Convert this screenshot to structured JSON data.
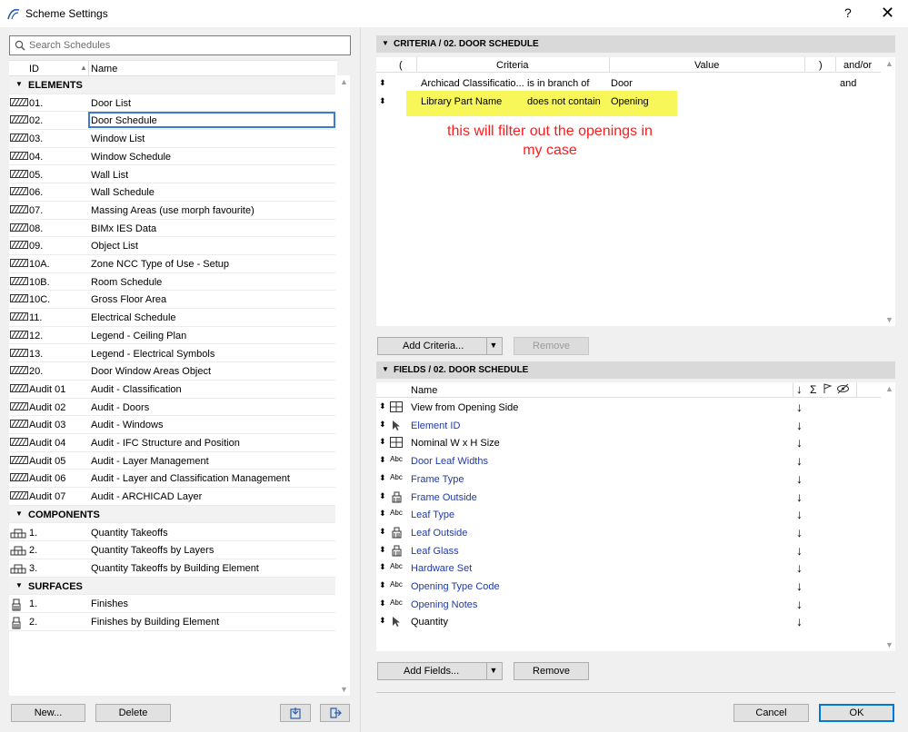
{
  "window": {
    "title": "Scheme Settings",
    "help": "?",
    "close": "✕"
  },
  "search": {
    "placeholder": "Search Schedules"
  },
  "list": {
    "col_id": "ID",
    "col_name": "Name",
    "groups": {
      "elements": "ELEMENTS",
      "components": "COMPONENTS",
      "surfaces": "SURFACES"
    },
    "elements": [
      {
        "id": "01.",
        "name": "Door List"
      },
      {
        "id": "02.",
        "name": "Door Schedule"
      },
      {
        "id": "03.",
        "name": "Window List"
      },
      {
        "id": "04.",
        "name": "Window Schedule"
      },
      {
        "id": "05.",
        "name": "Wall List"
      },
      {
        "id": "06.",
        "name": "Wall Schedule"
      },
      {
        "id": "07.",
        "name": "Massing Areas (use morph favourite)"
      },
      {
        "id": "08.",
        "name": "BIMx IES Data"
      },
      {
        "id": "09.",
        "name": "Object List"
      },
      {
        "id": "10A.",
        "name": "Zone NCC Type of Use - Setup"
      },
      {
        "id": "10B.",
        "name": "Room Schedule"
      },
      {
        "id": "10C.",
        "name": "Gross Floor Area"
      },
      {
        "id": "11.",
        "name": "Electrical Schedule"
      },
      {
        "id": "12.",
        "name": "Legend - Ceiling Plan"
      },
      {
        "id": "13.",
        "name": "Legend - Electrical Symbols"
      },
      {
        "id": "20.",
        "name": "Door Window Areas Object"
      },
      {
        "id": "Audit 01",
        "name": "Audit - Classification"
      },
      {
        "id": "Audit 02",
        "name": "Audit - Doors"
      },
      {
        "id": "Audit 03",
        "name": "Audit - Windows"
      },
      {
        "id": "Audit 04",
        "name": "Audit - IFC Structure and Position"
      },
      {
        "id": "Audit 05",
        "name": "Audit - Layer Management"
      },
      {
        "id": "Audit 06",
        "name": "Audit - Layer and Classification Management"
      },
      {
        "id": "Audit 07",
        "name": "Audit - ARCHICAD Layer"
      }
    ],
    "components": [
      {
        "id": "1.",
        "name": "Quantity Takeoffs"
      },
      {
        "id": "2.",
        "name": "Quantity Takeoffs by Layers"
      },
      {
        "id": "3.",
        "name": "Quantity Takeoffs by Building Element"
      }
    ],
    "surfaces": [
      {
        "id": "1.",
        "name": "Finishes"
      },
      {
        "id": "2.",
        "name": "Finishes by Building Element"
      }
    ]
  },
  "left_buttons": {
    "new": "New...",
    "delete": "Delete"
  },
  "criteria": {
    "title": "CRITERIA / 02. DOOR SCHEDULE",
    "headers": {
      "open": "(",
      "criteria": "Criteria",
      "value": "Value",
      "close": ")",
      "andor": "and/or"
    },
    "rows": [
      {
        "field": "Archicad Classificatio...",
        "op": "is in branch of",
        "value": "Door",
        "andor": "and"
      },
      {
        "field": "Library Part Name",
        "op": "does not contain",
        "value": "Opening",
        "andor": ""
      }
    ],
    "annotation_line1": "this will filter out the openings in",
    "annotation_line2": "my case",
    "add_button": "Add Criteria...",
    "remove_button": "Remove"
  },
  "fields": {
    "title": "FIELDS / 02. DOOR SCHEDULE",
    "header_name": "Name",
    "header_sum": "Σ",
    "rows": [
      {
        "icon": "window-icon",
        "name": "View from Opening Side",
        "blue": false
      },
      {
        "icon": "pointer-icon",
        "name": "Element ID",
        "blue": true
      },
      {
        "icon": "window-icon",
        "name": "Nominal W x H Size",
        "blue": false
      },
      {
        "icon": "abc-icon",
        "name": "Door Leaf Widths",
        "blue": true
      },
      {
        "icon": "abc-icon",
        "name": "Frame Type",
        "blue": true
      },
      {
        "icon": "brush-icon",
        "name": "Frame Outside",
        "blue": true
      },
      {
        "icon": "abc-icon",
        "name": "Leaf Type",
        "blue": true
      },
      {
        "icon": "brush-icon",
        "name": "Leaf Outside",
        "blue": true
      },
      {
        "icon": "brush-icon",
        "name": "Leaf Glass",
        "blue": true
      },
      {
        "icon": "abc-icon",
        "name": "Hardware Set",
        "blue": true
      },
      {
        "icon": "abc-icon",
        "name": "Opening Type Code",
        "blue": true
      },
      {
        "icon": "abc-icon",
        "name": "Opening Notes",
        "blue": true
      },
      {
        "icon": "pointer-icon",
        "name": "Quantity",
        "blue": false
      }
    ],
    "add_button": "Add Fields...",
    "remove_button": "Remove"
  },
  "dialog_buttons": {
    "cancel": "Cancel",
    "ok": "OK"
  },
  "colors": {
    "highlight": "#f7f75a",
    "annotation": "#ff1a1a",
    "link_blue": "#1f3aa8",
    "selection": "#3a7bd5"
  }
}
